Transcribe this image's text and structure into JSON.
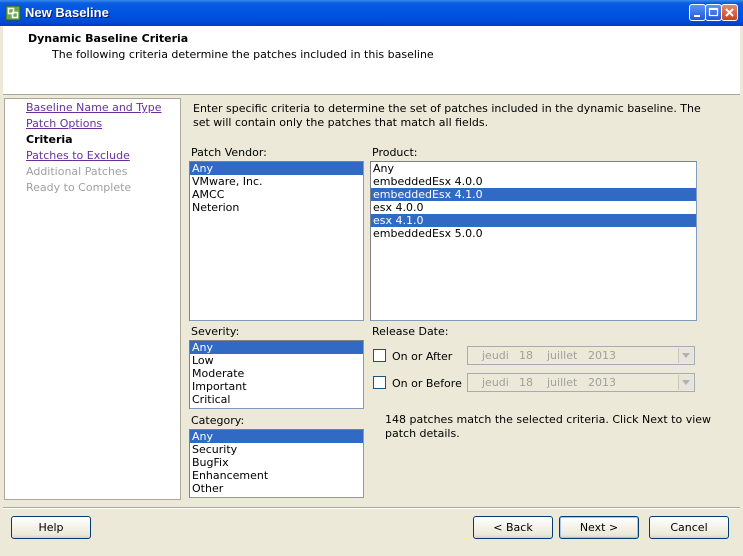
{
  "window": {
    "title": "New Baseline"
  },
  "header": {
    "title": "Dynamic Baseline Criteria",
    "subtitle": "The following criteria determine the patches included in this baseline"
  },
  "nav": {
    "items": [
      {
        "label": "Baseline Name and Type",
        "state": "link"
      },
      {
        "label": "Patch Options",
        "state": "link"
      },
      {
        "label": "Criteria",
        "state": "current"
      },
      {
        "label": "Patches to Exclude",
        "state": "link"
      },
      {
        "label": "Additional Patches",
        "state": "disabled"
      },
      {
        "label": "Ready to Complete",
        "state": "disabled"
      }
    ]
  },
  "intro": "Enter specific criteria to determine the set of patches included in the dynamic baseline.  The set will contain only the patches that match all fields.",
  "patch_vendor": {
    "label": "Patch Vendor:",
    "items": [
      {
        "text": "Any",
        "selected": true
      },
      {
        "text": "VMware, Inc.",
        "selected": false
      },
      {
        "text": "AMCC",
        "selected": false
      },
      {
        "text": "Neterion",
        "selected": false
      }
    ]
  },
  "product": {
    "label": "Product:",
    "items": [
      {
        "text": "Any",
        "selected": false
      },
      {
        "text": "embeddedEsx 4.0.0",
        "selected": false
      },
      {
        "text": "embeddedEsx 4.1.0",
        "selected": true
      },
      {
        "text": "esx 4.0.0",
        "selected": false
      },
      {
        "text": "esx 4.1.0",
        "selected": true
      },
      {
        "text": "embeddedEsx 5.0.0",
        "selected": false
      }
    ]
  },
  "severity": {
    "label": "Severity:",
    "items": [
      {
        "text": "Any",
        "selected": true
      },
      {
        "text": "Low",
        "selected": false
      },
      {
        "text": "Moderate",
        "selected": false
      },
      {
        "text": "Important",
        "selected": false
      },
      {
        "text": "Critical",
        "selected": false
      }
    ]
  },
  "category": {
    "label": "Category:",
    "items": [
      {
        "text": "Any",
        "selected": true
      },
      {
        "text": "Security",
        "selected": false
      },
      {
        "text": "BugFix",
        "selected": false
      },
      {
        "text": "Enhancement",
        "selected": false
      },
      {
        "text": "Other",
        "selected": false
      }
    ]
  },
  "release_date": {
    "label": "Release Date:",
    "on_or_after": {
      "label": "On or After",
      "checked": false,
      "day_name": "jeudi",
      "day": "18",
      "month": "juillet",
      "year": "2013"
    },
    "on_or_before": {
      "label": "On or Before",
      "checked": false,
      "day_name": "jeudi",
      "day": "18",
      "month": "juillet",
      "year": "2013"
    }
  },
  "match_text": "148 patches match the selected criteria. Click Next to view patch details.",
  "buttons": {
    "help": "Help",
    "back": "< Back",
    "next": "Next >",
    "cancel": "Cancel"
  },
  "colors": {
    "selection": "#316ac5",
    "titlebar": "#0054e3",
    "link": "#6b2f9c"
  }
}
